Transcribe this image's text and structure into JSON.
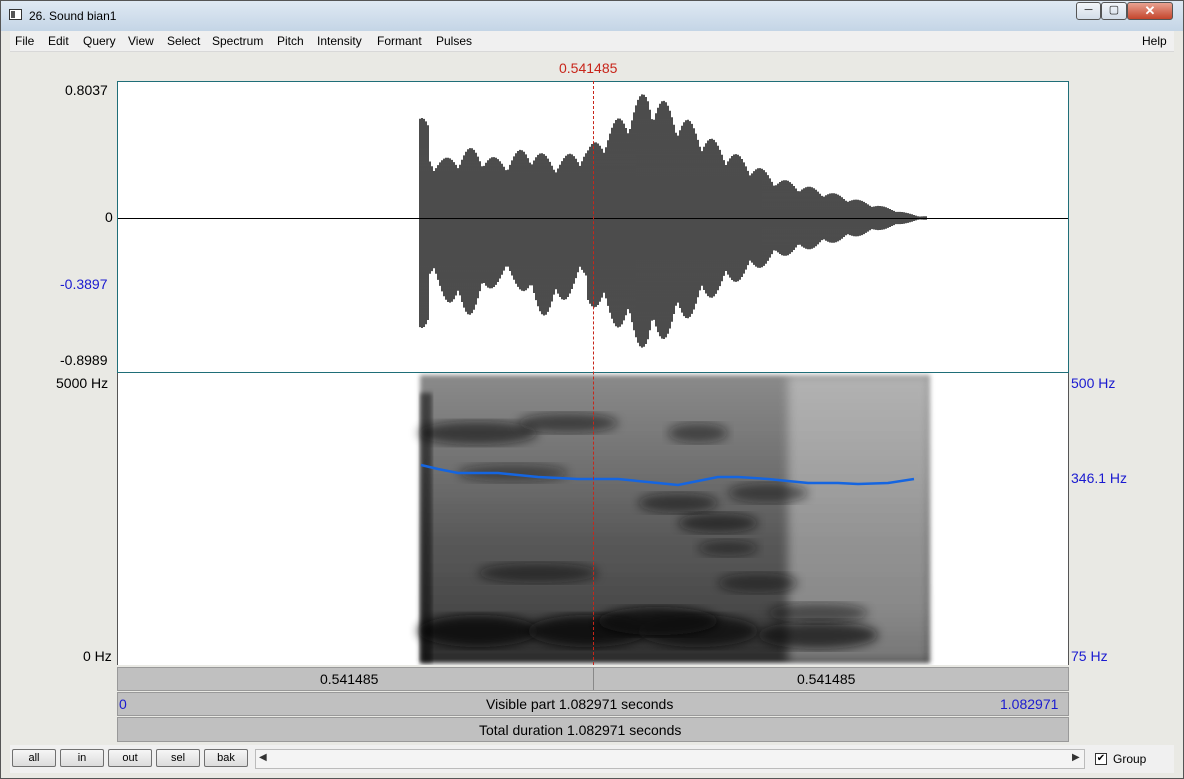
{
  "window": {
    "title": "26. Sound bian1",
    "controls": {
      "minimize": "─",
      "maximize": "▢",
      "close": "✕"
    }
  },
  "menu": {
    "items": [
      "File",
      "Edit",
      "Query",
      "View",
      "Select",
      "Spectrum",
      "Pitch",
      "Intensity",
      "Formant",
      "Pulses"
    ],
    "help": "Help"
  },
  "cursor": {
    "time": "0.541485",
    "color": "#c8251a"
  },
  "waveform": {
    "max_label": "0.8037",
    "zero_label": "0",
    "cursor_value_label": "-0.3897",
    "min_label": "-0.8989"
  },
  "spectrogram": {
    "top_freq_label": "5000 Hz",
    "bottom_freq_label": "0 Hz",
    "pitch_top_label": "500 Hz",
    "pitch_cursor_label": "346.1 Hz",
    "pitch_bottom_label": "75 Hz",
    "pitch_color": "#1565e0"
  },
  "time_bars": {
    "left_segment": "0.541485",
    "right_segment": "0.541485",
    "visible_start": "0",
    "visible_part": "Visible part 1.082971 seconds",
    "visible_end": "1.082971",
    "total_duration": "Total duration 1.082971 seconds"
  },
  "bottom_buttons": [
    "all",
    "in",
    "out",
    "sel",
    "bak"
  ],
  "scroll_arrows": {
    "left": "◀",
    "right": "▶"
  },
  "group": {
    "label": "Group",
    "checked": true,
    "check_mark": "✔"
  }
}
